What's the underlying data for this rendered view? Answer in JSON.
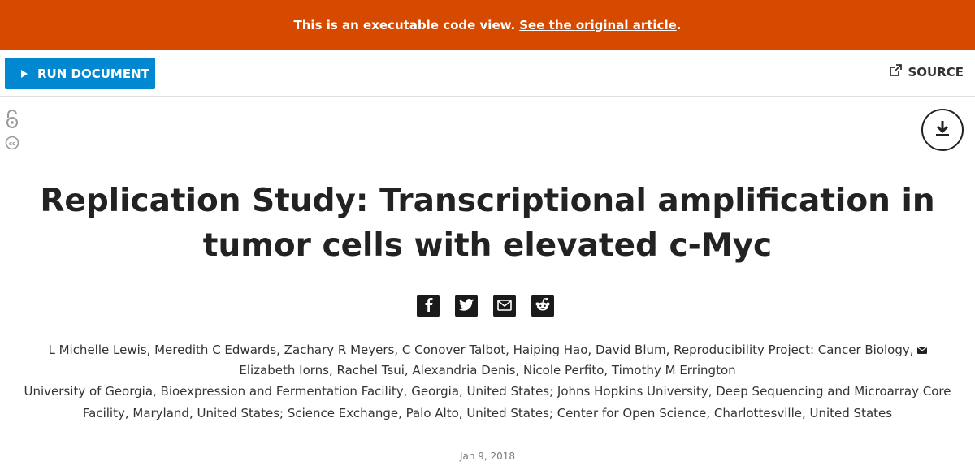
{
  "banner": {
    "text": "This is an executable code view.",
    "link_text": "See the original article",
    "trailing": ".",
    "color": "#d64a00"
  },
  "toolbar": {
    "run_label": "RUN DOCUMENT",
    "source_label": "SOURCE",
    "run_color": "#0288d1"
  },
  "icons": {
    "open_access": "open-access-icon",
    "cc": "creative-commons-icon",
    "download": "download-icon",
    "share": [
      "facebook-icon",
      "twitter-icon",
      "email-icon",
      "reddit-icon"
    ]
  },
  "article": {
    "title": "Replication Study: Transcriptional amplification in tumor cells with elevated c-Myc",
    "authors_line1": "L Michelle Lewis, Meredith C Edwards, Zachary R Meyers, C Conover Talbot, Haiping Hao, David Blum, Reproducibility Project: Cancer Biology,",
    "authors_line2": "Elizabeth Iorns, Rachel Tsui, Alexandria Denis, Nicole Perfito, Timothy M Errington",
    "affiliations": "University of Georgia, Bioexpression and Fermentation Facility, Georgia, United States; Johns Hopkins University, Deep Sequencing and Microarray Core Facility, Maryland, United States; Science Exchange, Palo Alto, United States; Center for Open Science, Charlottesville, United States",
    "date": "Jan 9, 2018"
  }
}
